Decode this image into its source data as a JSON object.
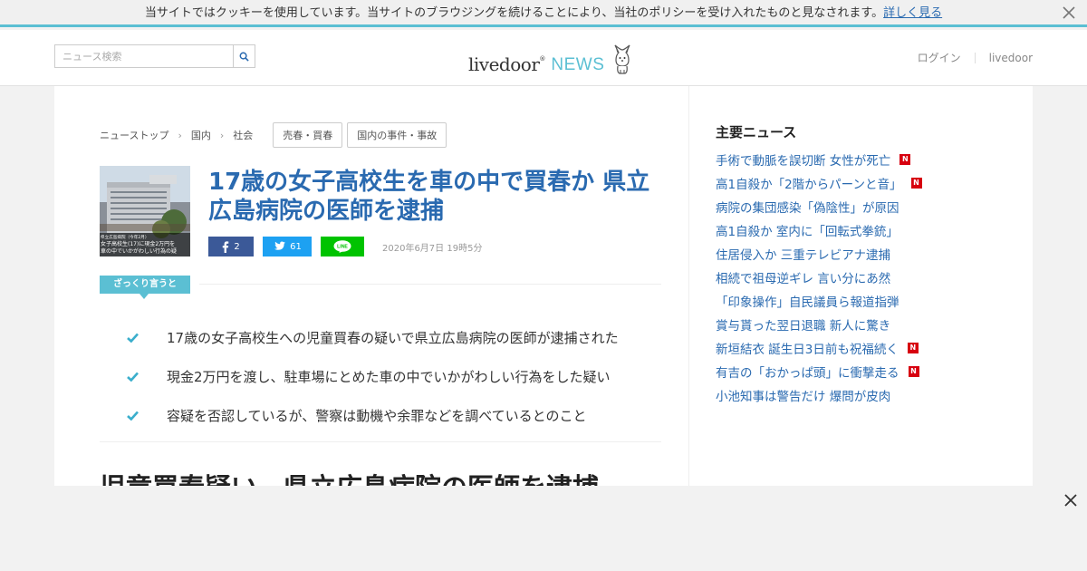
{
  "cookie": {
    "text": "当サイトではクッキーを使用しています。当サイトのブラウジングを続けることにより、当社のポリシーを受け入れたものと見なされます。",
    "link": "詳しく見る"
  },
  "header": {
    "search_placeholder": "ニュース検索",
    "logo_main": "livedoor",
    "logo_sup": "®",
    "logo_news": "NEWS",
    "login": "ログイン",
    "livedoor": "livedoor"
  },
  "breadcrumb": [
    "ニューストップ",
    "国内",
    "社会"
  ],
  "tags": [
    "売春・買春",
    "国内の事件・事故"
  ],
  "article": {
    "title": "17歳の女子高校生を車の中で買春か 県立広島病院の医師を逮捕",
    "fb_count": "2",
    "tw_count": "61",
    "line_label": "LINE",
    "date": "2020年6月7日 19時5分",
    "summary_label": "ざっくり言うと",
    "points": [
      "17歳の女子高校生への児童買春の疑いで県立広島病院の医師が逮捕された",
      "現金2万円を渡し、駐車場にとめた車の中でいかがわしい行為をした疑い",
      "容疑を否認しているが、警察は動機や余罪などを調べているとのこと"
    ],
    "headline2": "児童買春疑い　県立広島病院の医師を逮捕"
  },
  "thumb": {
    "caption_top": "県立広島病院（今年2月）",
    "caption_line1": "女子高校生(17)に現金2万円を",
    "caption_line2": "車の中でいかがわしい行為の疑"
  },
  "sidebar": {
    "title": "主要ニュース",
    "items": [
      {
        "label": "手術で動脈を誤切断 女性が死亡",
        "new": true
      },
      {
        "label": "高1自殺か「2階からパーンと音」",
        "new": true
      },
      {
        "label": "病院の集団感染「偽陰性」が原因",
        "new": false
      },
      {
        "label": "高1自殺か 室内に「回転式拳銃」",
        "new": false
      },
      {
        "label": "住居侵入か 三重テレビアナ逮捕",
        "new": false
      },
      {
        "label": "相続で祖母逆ギレ 言い分にあ然",
        "new": false
      },
      {
        "label": "「印象操作」自民議員ら報道指弾",
        "new": false
      },
      {
        "label": "賞与貰った翌日退職 新人に驚き",
        "new": false
      },
      {
        "label": "新垣結衣 誕生日3日前も祝福続く",
        "new": true
      },
      {
        "label": "有吉の「おかっぱ頭」に衝撃走る",
        "new": true
      },
      {
        "label": "小池知事は警告だけ 爆問が皮肉",
        "new": false
      }
    ],
    "new_badge": "N"
  },
  "icons": {
    "close": "close-icon",
    "search": "search-icon",
    "check": "check-icon",
    "dog": "dog-mascot-icon"
  },
  "colors": {
    "accent": "#5bbfd3",
    "link": "#2a6ab0",
    "facebook": "#3b5998",
    "twitter": "#1da1f2",
    "line": "#00c300",
    "new_badge": "#d7000f"
  }
}
